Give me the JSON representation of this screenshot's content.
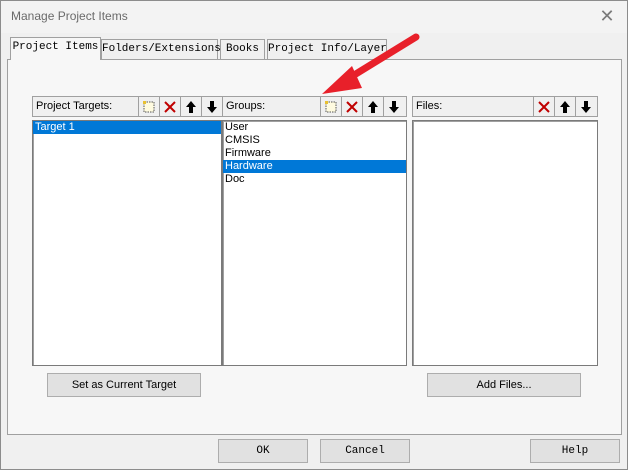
{
  "window": {
    "title": "Manage Project Items",
    "close_glyph": "✕"
  },
  "tabs": [
    {
      "label": "Project Items",
      "active": true
    },
    {
      "label": "Folders/Extensions",
      "active": false
    },
    {
      "label": "Books",
      "active": false
    },
    {
      "label": "Project Info/Layer",
      "active": false
    }
  ],
  "targets": {
    "label": "Project Targets:",
    "items": [
      "Target 1"
    ],
    "selected_index": 0,
    "set_current_label": "Set as Current Target"
  },
  "groups": {
    "label": "Groups:",
    "items": [
      "User",
      "CMSIS",
      "Firmware",
      "Hardware",
      "Doc"
    ],
    "selected_index": 3
  },
  "files": {
    "label": "Files:",
    "items": [],
    "add_files_label": "Add Files..."
  },
  "footer": {
    "ok_label": "OK",
    "cancel_label": "Cancel",
    "help_label": "Help"
  },
  "colors": {
    "selection": "#0078d7",
    "delete_icon": "#c00000",
    "annotation_arrow": "#e8202a"
  },
  "icons": [
    "new-item-icon",
    "delete-icon",
    "move-up-icon",
    "move-down-icon",
    "close-icon"
  ]
}
